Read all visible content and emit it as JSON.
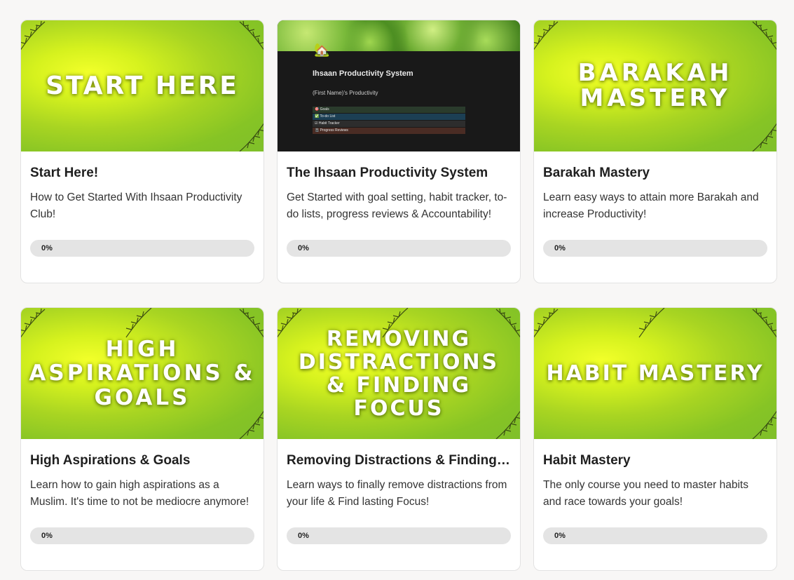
{
  "colors": {
    "page_bg": "#f8f7f6",
    "card_bg": "#ffffff",
    "banner_green": "#a9d522",
    "progress_track": "#e4e4e4",
    "progress_fill": "#7fbf2a"
  },
  "courses": [
    {
      "banner_text": "START HERE",
      "title": "Start Here!",
      "description": "How to Get Started With Ihsaan Productivity Club!",
      "progress": 0,
      "progress_label": "0%"
    },
    {
      "banner": {
        "emoji": "🏡",
        "title": "Ihsaan Productivity System",
        "subtitle": "(First Name)'s Productivity",
        "rows": [
          {
            "icon": "🎯",
            "label": "Goals",
            "color": "#2a3b2c"
          },
          {
            "icon": "✅",
            "label": "To-do List",
            "color": "#1c3f54"
          },
          {
            "icon": "☑",
            "label": "Habit Tracker",
            "color": "#2d2d2d"
          },
          {
            "icon": "📓",
            "label": "Progress Reviews",
            "color": "#4a2c24"
          }
        ]
      },
      "title": "The Ihsaan Productivity System",
      "description": "Get Started with goal setting, habit tracker, to-do lists, progress reviews & Accountability!",
      "progress": 0,
      "progress_label": "0%"
    },
    {
      "banner_text": "BARAKAH MASTERY",
      "title": "Barakah Mastery",
      "description": "Learn easy ways to attain more Barakah and increase Productivity!",
      "progress": 0,
      "progress_label": "0%"
    },
    {
      "banner_text": "HIGH ASPIRATIONS & GOALS",
      "title": "High Aspirations & Goals",
      "description": "Learn how to gain high aspirations as a Muslim. It's time to not be mediocre anymore!",
      "progress": 0,
      "progress_label": "0%"
    },
    {
      "banner_text": "REMOVING DISTRACTIONS & FINDING FOCUS",
      "title": "Removing Distractions & Finding Focus",
      "description": "Learn ways to finally remove distractions from your life & Find lasting Focus!",
      "progress": 0,
      "progress_label": "0%"
    },
    {
      "banner_text": "HABIT MASTERY",
      "title": "Habit Mastery",
      "description": "The only course you need to master habits and race towards your goals!",
      "progress": 0,
      "progress_label": "0%"
    }
  ]
}
